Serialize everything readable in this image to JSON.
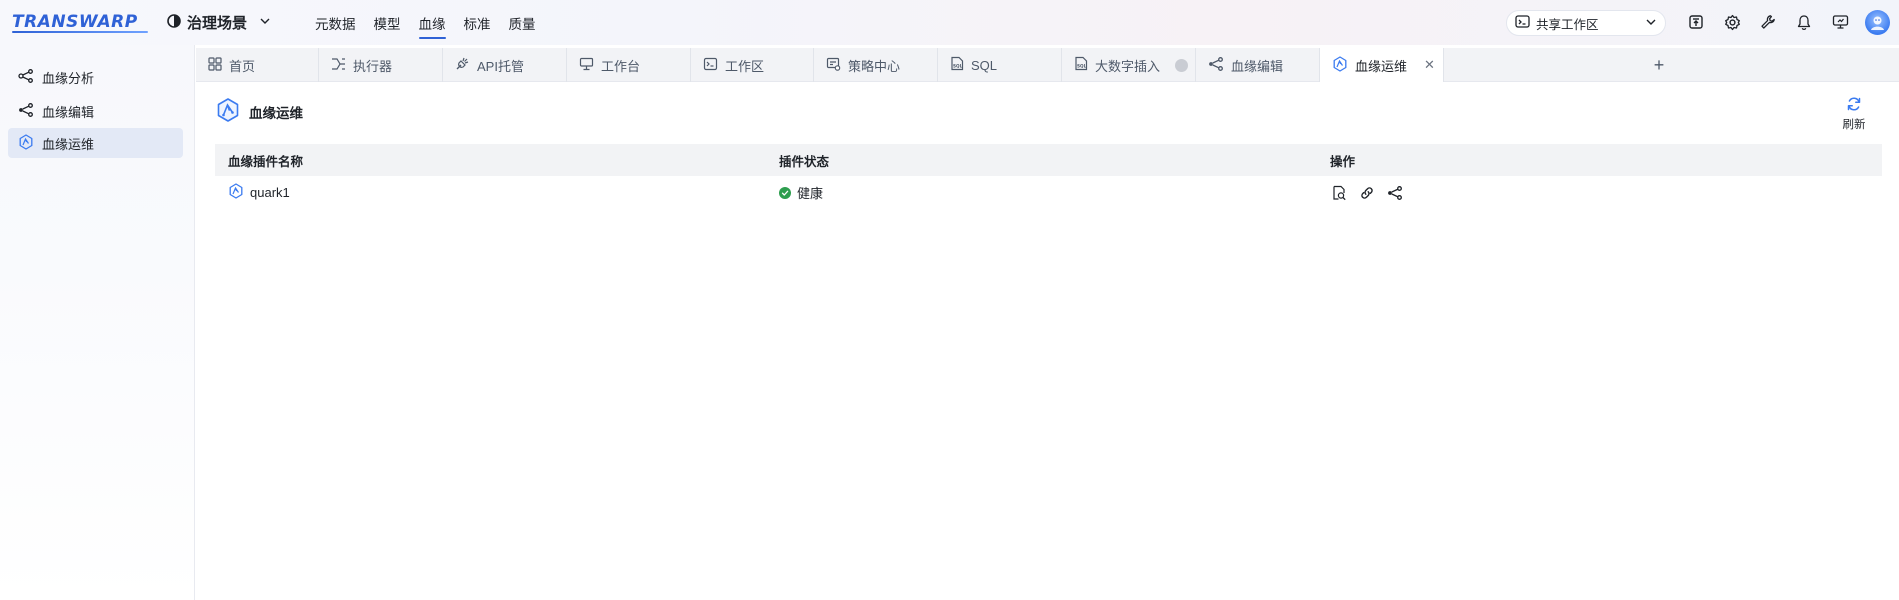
{
  "brand": {
    "logo_text": "TRANSWARP"
  },
  "scene": {
    "label": "治理场景"
  },
  "top_nav": {
    "items": [
      {
        "label": "元数据"
      },
      {
        "label": "模型"
      },
      {
        "label": "血缘",
        "active": true
      },
      {
        "label": "标准"
      },
      {
        "label": "质量"
      }
    ]
  },
  "workspace": {
    "label": "共享工作区"
  },
  "header_icons": [
    "publish-icon",
    "gear-icon",
    "wrench-icon",
    "bell-icon",
    "monitor-icon",
    "avatar"
  ],
  "sidebar": {
    "items": [
      {
        "label": "血缘分析",
        "icon": "lineage-graph-icon"
      },
      {
        "label": "血缘编辑",
        "icon": "lineage-edit-icon"
      },
      {
        "label": "血缘运维",
        "icon": "lineage-ops-icon",
        "active": true
      }
    ]
  },
  "tabs": {
    "items": [
      {
        "label": "首页",
        "icon": "grid-icon"
      },
      {
        "label": "执行器",
        "icon": "executor-icon"
      },
      {
        "label": "API托管",
        "icon": "api-icon"
      },
      {
        "label": "工作台",
        "icon": "workbench-icon"
      },
      {
        "label": "工作区",
        "icon": "terminal-icon"
      },
      {
        "label": "策略中心",
        "icon": "policy-icon"
      },
      {
        "label": "SQL",
        "icon": "sql-file-icon"
      },
      {
        "label": "大数字插入",
        "icon": "sql-file-icon"
      },
      {
        "label": "血缘编辑",
        "icon": "lineage-edit-icon"
      },
      {
        "label": "血缘运维",
        "icon": "lineage-ops-icon",
        "active": true
      }
    ],
    "close_symbol": "✕",
    "add_symbol": "+"
  },
  "page": {
    "title": "血缘运维",
    "refresh_label": "刷新"
  },
  "table": {
    "columns": [
      "血缘插件名称",
      "插件状态",
      "操作"
    ],
    "rows": [
      {
        "name": "quark1",
        "status": "健康",
        "status_color": "#2e9e4f"
      }
    ]
  },
  "colors": {
    "accent": "#2f62d6",
    "healthy": "#2e9e4f"
  }
}
